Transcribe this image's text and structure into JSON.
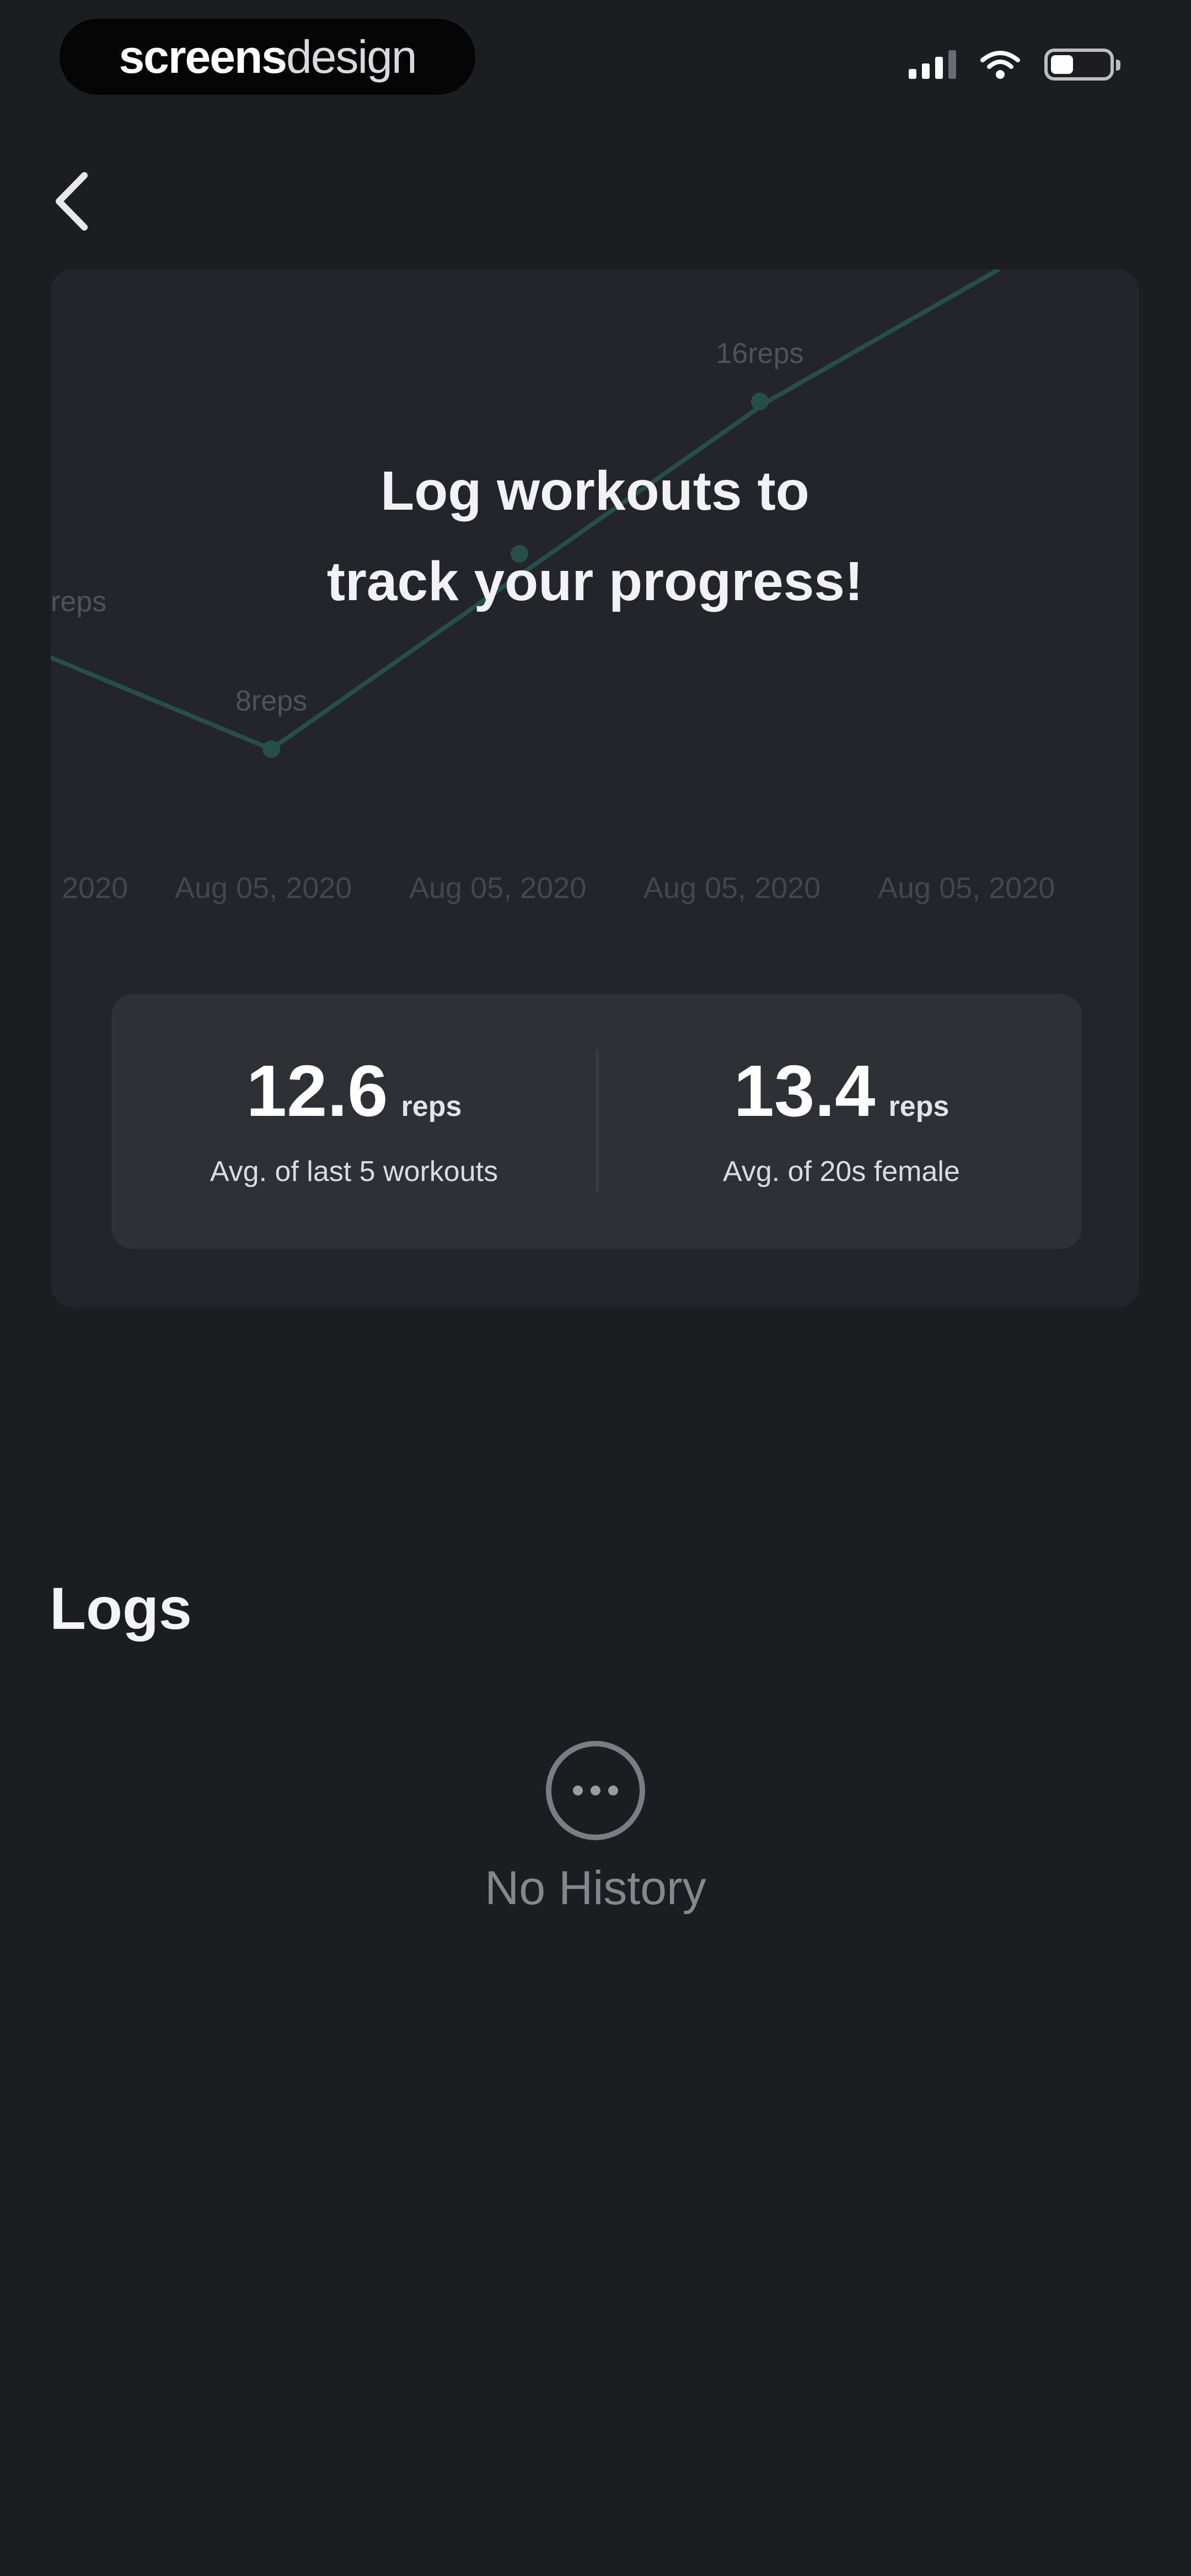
{
  "status_bar": {
    "brand_part1": "screens",
    "brand_part2": "design"
  },
  "progress_card": {
    "empty_line1": "Log workouts to",
    "empty_line2": "track your progress!",
    "chart_labels": {
      "point_low": "8reps",
      "point_high": "16reps",
      "axis_left": "reps",
      "x_ticks": [
        "2020",
        "Aug 05, 2020",
        "Aug 05, 2020",
        "Aug 05, 2020",
        "Aug 05, 2020"
      ]
    },
    "line_color": "#2fa88f",
    "stats": {
      "left": {
        "value": "12.6",
        "unit": "reps",
        "caption": "Avg. of last 5 workouts"
      },
      "right": {
        "value": "13.4",
        "unit": "reps",
        "caption": "Avg. of 20s female"
      }
    }
  },
  "logs": {
    "title": "Logs",
    "empty_label": "No History"
  }
}
